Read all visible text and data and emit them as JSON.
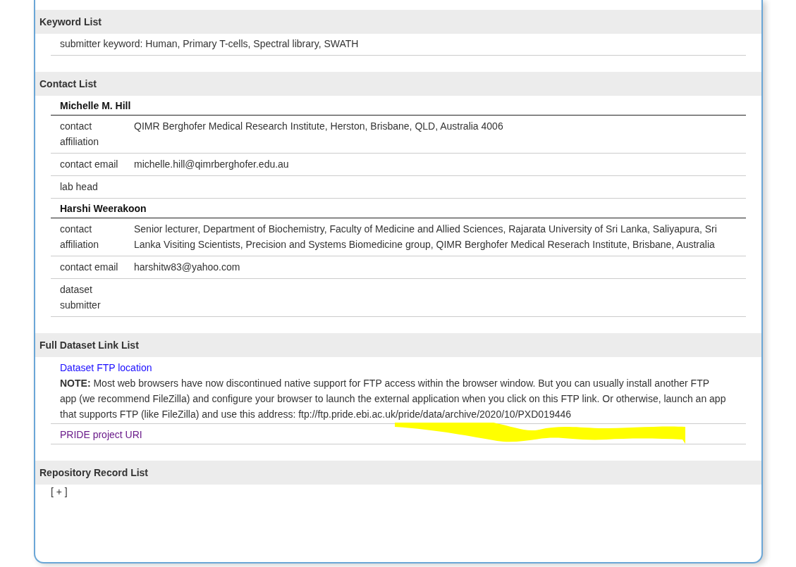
{
  "sections": [
    {
      "title": "Keyword List",
      "kind": "keywords",
      "keywords": [
        "submitter keyword: Human, Primary T-cells, Spectral library, SWATH"
      ]
    },
    {
      "title": "Contact List",
      "kind": "contacts",
      "contacts": [
        {
          "name": "Michelle M. Hill",
          "fields": [
            {
              "label": "contact affiliation",
              "value": "QIMR Berghofer Medical Research Institute, Herston, Brisbane, QLD, Australia 4006"
            },
            {
              "label": "contact email",
              "value": "michelle.hill@qimrberghofer.edu.au"
            },
            {
              "label": "lab head"
            }
          ]
        },
        {
          "name": "Harshi Weerakoon",
          "fields": [
            {
              "label": "contact affiliation",
              "value": "Senior lecturer, Department of Biochemistry, Faculty of Medicine and Allied Sciences, Rajarata University of Sri Lanka, Saliyapura, Sri Lanka Visiting Scientists, Precision and Systems Biomedicine group, QIMR Berghofer Medical Reserach Institute, Brisbane, Australia"
            },
            {
              "label": "contact email",
              "value": "harshitw83@yahoo.com"
            },
            {
              "label": "dataset submitter"
            }
          ]
        }
      ]
    },
    {
      "title": "Full Dataset Link List",
      "kind": "links",
      "links": [
        {
          "label": "Dataset FTP location",
          "visited": false,
          "note": "**NOTE:** Most web browsers have now discontinued native support for FTP access within the browser window. But you can usually install another FTP app (we recommend FileZilla) and configure your browser to launch the external application when you click on this FTP link. Or otherwise, launch an app that supports FTP (like FileZilla) and use this address: ftp://ftp.pride.ebi.ac.uk/pride/data/archive/2020/10/PXD019446"
        },
        {
          "label": "PRIDE project URI",
          "visited": true
        }
      ]
    },
    {
      "title": "Repository Record List",
      "kind": "expander",
      "toggle": "[ + ]"
    }
  ],
  "highlight": {
    "kind": "scribble"
  }
}
